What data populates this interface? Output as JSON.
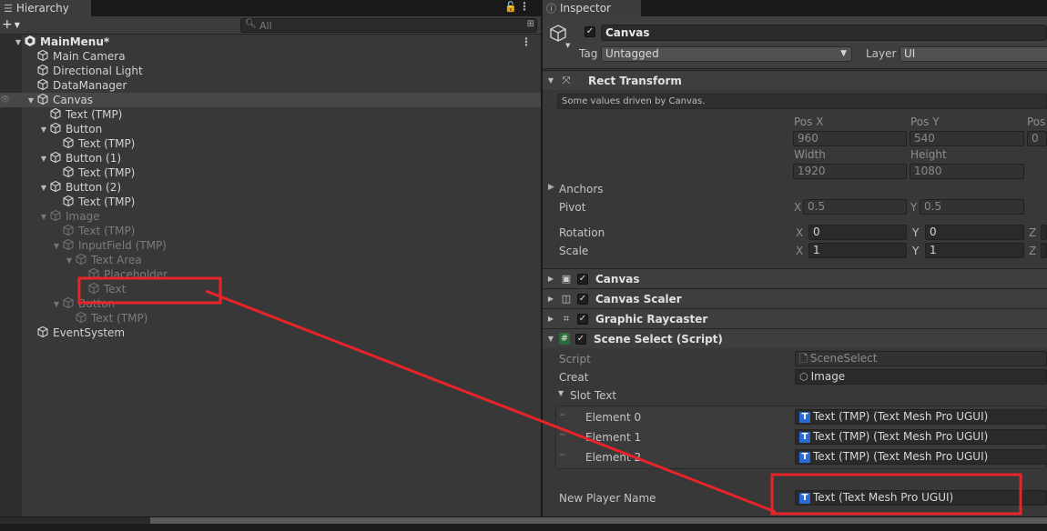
{
  "hierarchy": {
    "tab_label": "Hierarchy",
    "search_placeholder": "All",
    "add_label": "+",
    "items": [
      {
        "label": "MainMenu*",
        "level": 0,
        "fold": "open",
        "root": true,
        "dim": false
      },
      {
        "label": "Main Camera",
        "level": 1,
        "fold": "",
        "dim": false
      },
      {
        "label": "Directional Light",
        "level": 1,
        "fold": "",
        "dim": false
      },
      {
        "label": "DataManager",
        "level": 1,
        "fold": "",
        "dim": false
      },
      {
        "label": "Canvas",
        "level": 1,
        "fold": "open",
        "dim": false,
        "selected": true
      },
      {
        "label": "Text (TMP)",
        "level": 2,
        "fold": "",
        "dim": false
      },
      {
        "label": "Button",
        "level": 2,
        "fold": "open",
        "dim": false
      },
      {
        "label": "Text (TMP)",
        "level": 3,
        "fold": "",
        "dim": false
      },
      {
        "label": "Button (1)",
        "level": 2,
        "fold": "open",
        "dim": false
      },
      {
        "label": "Text (TMP)",
        "level": 3,
        "fold": "",
        "dim": false
      },
      {
        "label": "Button (2)",
        "level": 2,
        "fold": "open",
        "dim": false
      },
      {
        "label": "Text (TMP)",
        "level": 3,
        "fold": "",
        "dim": false
      },
      {
        "label": "Image",
        "level": 2,
        "fold": "open",
        "dim": true
      },
      {
        "label": "Text (TMP)",
        "level": 3,
        "fold": "",
        "dim": true
      },
      {
        "label": "InputField (TMP)",
        "level": 3,
        "fold": "open",
        "dim": true
      },
      {
        "label": "Text Area",
        "level": 4,
        "fold": "open",
        "dim": true
      },
      {
        "label": "Placeholder",
        "level": 5,
        "fold": "",
        "dim": true
      },
      {
        "label": "Text",
        "level": 5,
        "fold": "",
        "dim": true
      },
      {
        "label": "Button",
        "level": 3,
        "fold": "open",
        "dim": true
      },
      {
        "label": "Text (TMP)",
        "level": 4,
        "fold": "",
        "dim": true
      },
      {
        "label": "EventSystem",
        "level": 1,
        "fold": "",
        "dim": false
      }
    ]
  },
  "inspector": {
    "tab_label": "Inspector",
    "object_name": "Canvas",
    "tag_label": "Tag",
    "tag_value": "Untagged",
    "layer_label": "Layer",
    "layer_value": "UI",
    "rect_transform": {
      "title": "Rect Transform",
      "note": "Some values driven by Canvas.",
      "pos_x_label": "Pos X",
      "pos_y_label": "Pos Y",
      "pos_z_label": "Pos",
      "pos_x": "960",
      "pos_y": "540",
      "pos_z": "0",
      "width_label": "Width",
      "height_label": "Height",
      "width": "1920",
      "height": "1080",
      "anchors_label": "Anchors",
      "pivot_label": "Pivot",
      "pivot_x": "0.5",
      "pivot_y": "0.5",
      "rotation_label": "Rotation",
      "rot_x": "0",
      "rot_y": "0",
      "scale_label": "Scale",
      "scale_x": "1",
      "scale_y": "1"
    },
    "components": [
      {
        "name": "Canvas",
        "icon": "canvas-icon"
      },
      {
        "name": "Canvas Scaler",
        "icon": "canvas-scaler-icon"
      },
      {
        "name": "Graphic Raycaster",
        "icon": "raycaster-icon"
      }
    ],
    "scene_select": {
      "title": "Scene Select (Script)",
      "script_label": "Script",
      "script_value": "SceneSelect",
      "creat_label": "Creat",
      "creat_value": "Image",
      "slot_text_label": "Slot Text",
      "elements": [
        {
          "label": "Element 0",
          "value": "Text (TMP) (Text Mesh Pro UGUI)"
        },
        {
          "label": "Element 1",
          "value": "Text (TMP) (Text Mesh Pro UGUI)"
        },
        {
          "label": "Element 2",
          "value": "Text (TMP) (Text Mesh Pro UGUI)"
        }
      ],
      "new_player_label": "New Player Name",
      "new_player_value": "Text (Text Mesh Pro UGUI)"
    },
    "axis": {
      "x": "X",
      "y": "Y",
      "z": "Z"
    }
  },
  "annotation_color": "#e8232a"
}
